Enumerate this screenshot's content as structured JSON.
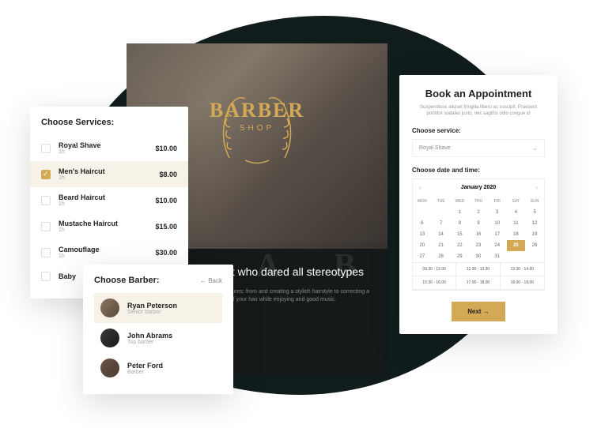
{
  "hero": {
    "logo_main": "BARBER",
    "logo_sub": "SHOP",
    "bg_letters": "A B",
    "title": "ershop is the first who dared all stereotypes",
    "title_visible_prefix": "",
    "description": "includes many methods and procedures: from and creating a stylish hairstyle to correcting a eyebrows. Take care of your hair while enjoying and good music."
  },
  "services_card": {
    "title": "Choose Services:",
    "items": [
      {
        "name": "Royal Shave",
        "duration": "1h",
        "price": "$10.00",
        "selected": false
      },
      {
        "name": "Men's Haircut",
        "duration": "1h",
        "price": "$8.00",
        "selected": true
      },
      {
        "name": "Beard Haircut",
        "duration": "1h",
        "price": "$10.00",
        "selected": false
      },
      {
        "name": "Mustache Haircut",
        "duration": "1h",
        "price": "$15.00",
        "selected": false
      },
      {
        "name": "Camouflage",
        "duration": "1h",
        "price": "$30.00",
        "selected": false
      },
      {
        "name": "Baby",
        "duration": "",
        "price": "",
        "selected": false
      }
    ]
  },
  "barbers_card": {
    "title": "Choose Barber:",
    "back_label": "←  Back",
    "items": [
      {
        "name": "Ryan Peterson",
        "role": "Senior barber",
        "selected": true
      },
      {
        "name": "John Abrams",
        "role": "Top barber",
        "selected": false
      },
      {
        "name": "Peter Ford",
        "role": "Barber",
        "selected": false
      }
    ]
  },
  "booking_card": {
    "title": "Book an Appointment",
    "description": "Suspendisse aliquet fringilla libero ac suscipit. Praesent porttitor sodales justo, nec sagittis odio congue id",
    "service_label": "Choose service:",
    "service_value": "Royal Shave",
    "datetime_label": "Choose date and time:",
    "calendar": {
      "month": "January",
      "year": "2020",
      "dow": [
        "MON",
        "TUE",
        "WED",
        "THU",
        "FRI",
        "SAT",
        "SUN"
      ],
      "leading_blank": 2,
      "days": 31,
      "selected_day": 25
    },
    "timeslots": [
      "09.30 - 12.00",
      "12.00 - 13.30",
      "13.30 - 14.00",
      "15.30 - 16.00",
      "17.00 - 18.00",
      "18.00 - 19.00"
    ],
    "next_label": "Next  →"
  }
}
